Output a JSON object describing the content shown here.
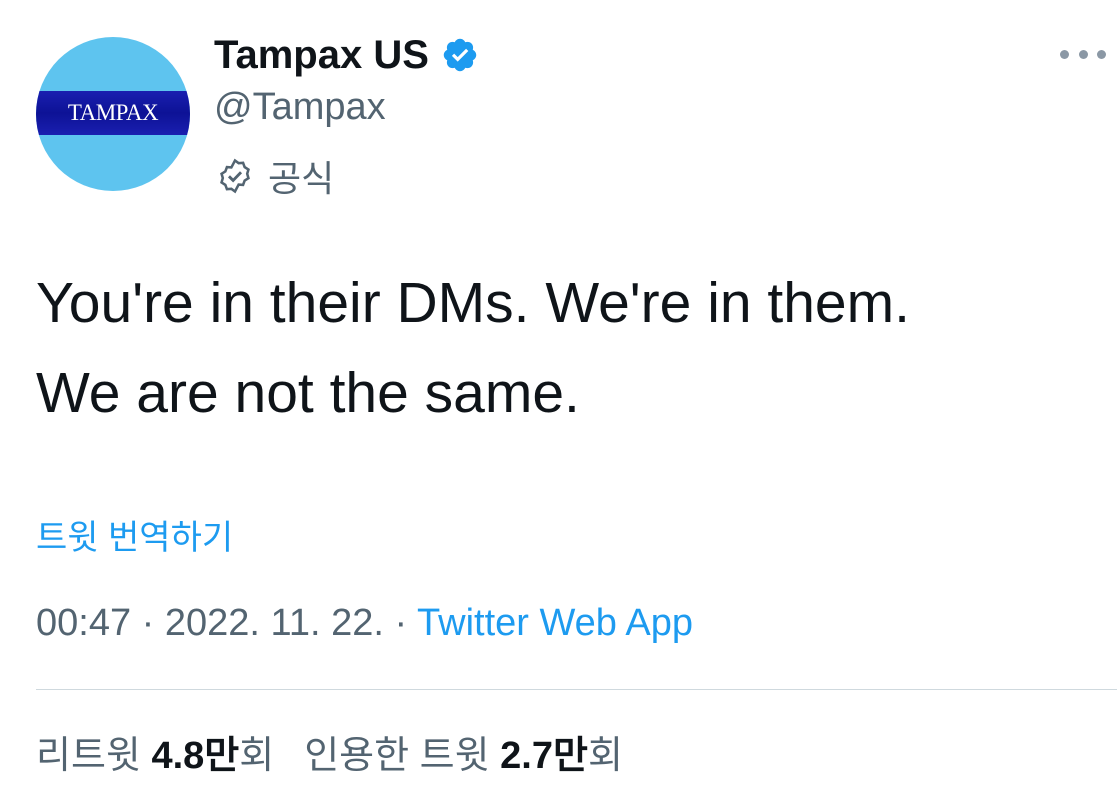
{
  "profile": {
    "avatar_text": "TAMPAX",
    "display_name": "Tampax US",
    "handle": "@Tampax",
    "official_label": "공식",
    "verified_icon": "verified-badge-icon",
    "official_icon": "official-badge-icon",
    "more_icon": "more-options-icon"
  },
  "tweet": {
    "line1": "You're in their DMs. We're in them.",
    "line2": "We are not the same.",
    "translate_label": "트윗 번역하기"
  },
  "meta": {
    "time": "00:47",
    "separator": "·",
    "date": "2022. 11. 22.",
    "source": "Twitter Web App"
  },
  "stats": {
    "retweets_label": "리트윗",
    "retweets_count": "4.8만",
    "retweets_suffix": "회",
    "quotes_label": "인용한 트윗",
    "quotes_count": "2.7만",
    "quotes_suffix": "회"
  },
  "colors": {
    "accent": "#1d9bf0",
    "secondary_text": "#536471",
    "primary_text": "#0f1419",
    "avatar_bg": "#5ec4ef",
    "logo_bg": "#0d1296"
  }
}
